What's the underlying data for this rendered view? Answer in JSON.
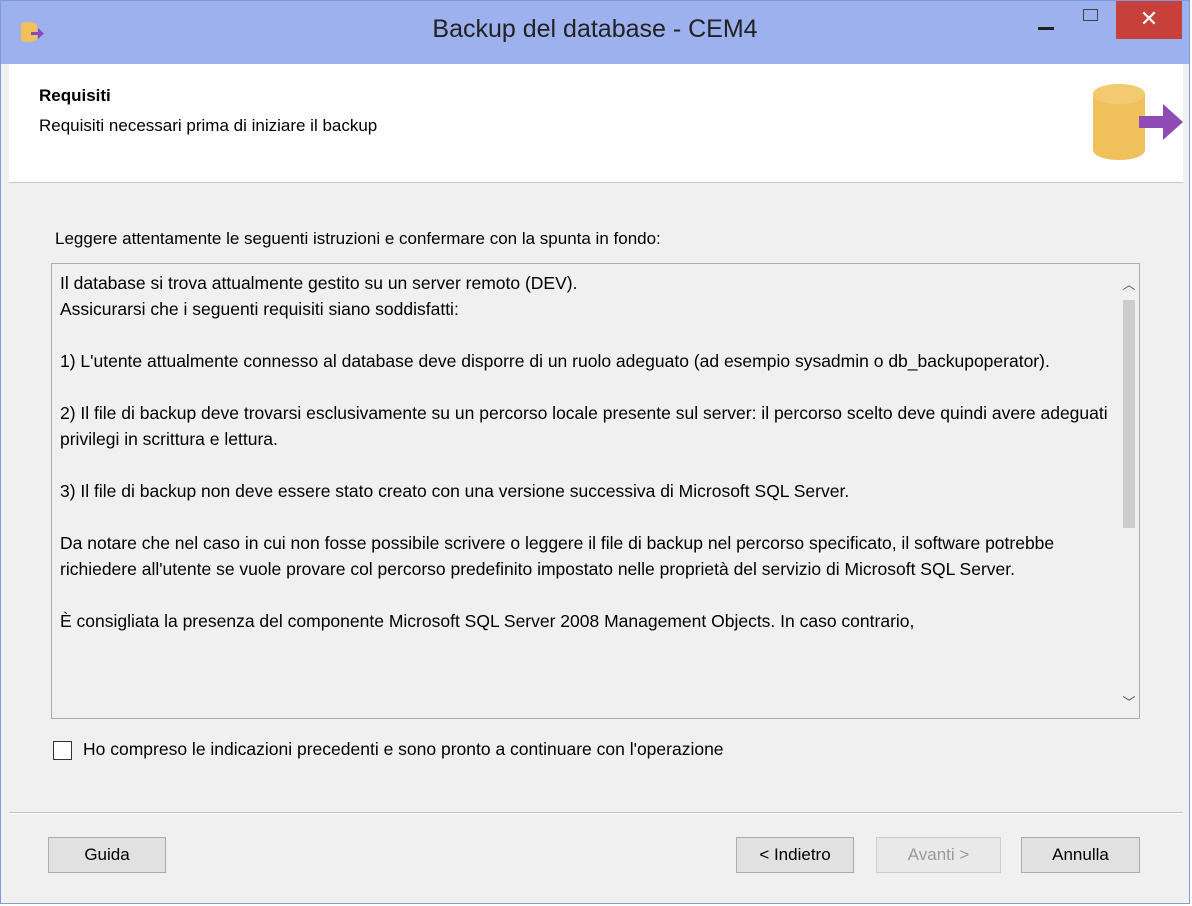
{
  "window": {
    "title": "Backup del database - CEM4",
    "close_glyph": "✕"
  },
  "header": {
    "title": "Requisiti",
    "subtitle": "Requisiti necessari prima di iniziare il backup"
  },
  "instruction": "Leggere attentamente le seguenti istruzioni e confermare con la spunta in fondo:",
  "requirements_text": [
    "Il database si trova attualmente gestito su un server remoto (DEV).",
    "Assicurarsi che i seguenti requisiti siano soddisfatti:",
    "",
    "1) L'utente attualmente connesso al database deve disporre di un ruolo adeguato (ad esempio sysadmin o db_backupoperator).",
    "",
    "2) Il file di backup deve trovarsi esclusivamente su un percorso locale presente sul server: il percorso scelto deve quindi avere adeguati privilegi in scrittura e lettura.",
    "",
    "3) Il file di backup non deve essere stato creato con una versione successiva di Microsoft SQL Server.",
    "",
    "Da notare che nel caso in cui non fosse possibile scrivere o leggere il file di backup nel percorso specificato, il software potrebbe richiedere all'utente se vuole provare col percorso predefinito impostato nelle proprietà del servizio di Microsoft SQL Server.",
    "",
    "È consigliata la presenza del componente Microsoft SQL Server 2008 Management Objects. In caso contrario,"
  ],
  "confirm_checkbox": {
    "label": "Ho compreso le indicazioni precedenti e sono pronto a continuare con l'operazione",
    "checked": false
  },
  "buttons": {
    "help": "Guida",
    "back": "< Indietro",
    "next": "Avanti >",
    "cancel": "Annulla"
  },
  "colors": {
    "titlebar": "#9db1ee",
    "close_button": "#c7403a",
    "db_icon": "#f0c15a",
    "arrow_icon": "#8e4bb5"
  }
}
